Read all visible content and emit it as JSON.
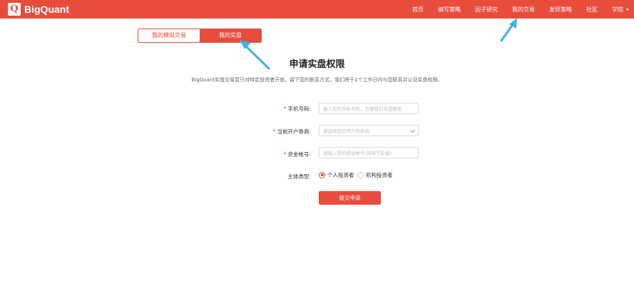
{
  "header": {
    "logo_letter": "Q",
    "brand": "BigQuant",
    "nav": [
      "首页",
      "编写策略",
      "因子研究",
      "我的交易",
      "发现策略",
      "社区",
      "学院"
    ],
    "bg_color": "#e84c3d"
  },
  "tabs": [
    {
      "label": "我的模拟交易",
      "active": false
    },
    {
      "label": "我的实盘",
      "active": true
    }
  ],
  "page": {
    "title": "申请实盘权限",
    "subtitle": "BigQuant实盘交易暂只对特定投资者开放，留下您的联系方式，我们将于1个工作日内与您联系并认证实盘权限。"
  },
  "form": {
    "phone": {
      "label": "手机号码:",
      "placeholder": "输入您的手机号码，方便我们与您联系",
      "required": true
    },
    "broker": {
      "label": "当前开户券商:",
      "placeholder": "请选择您已开户的券商",
      "required": true
    },
    "account": {
      "label": "资金帐号:",
      "placeholder": "请输入您的资金帐号(将用于实盘)",
      "required": true
    },
    "entity_type": {
      "label": "主体类型:",
      "options": [
        "个人投资者",
        "机构投资者"
      ],
      "selected": "个人投资者"
    },
    "submit_label": "提交申请",
    "required_mark": "*"
  },
  "annotations": {
    "arrow_color": "#3fb2e8"
  }
}
